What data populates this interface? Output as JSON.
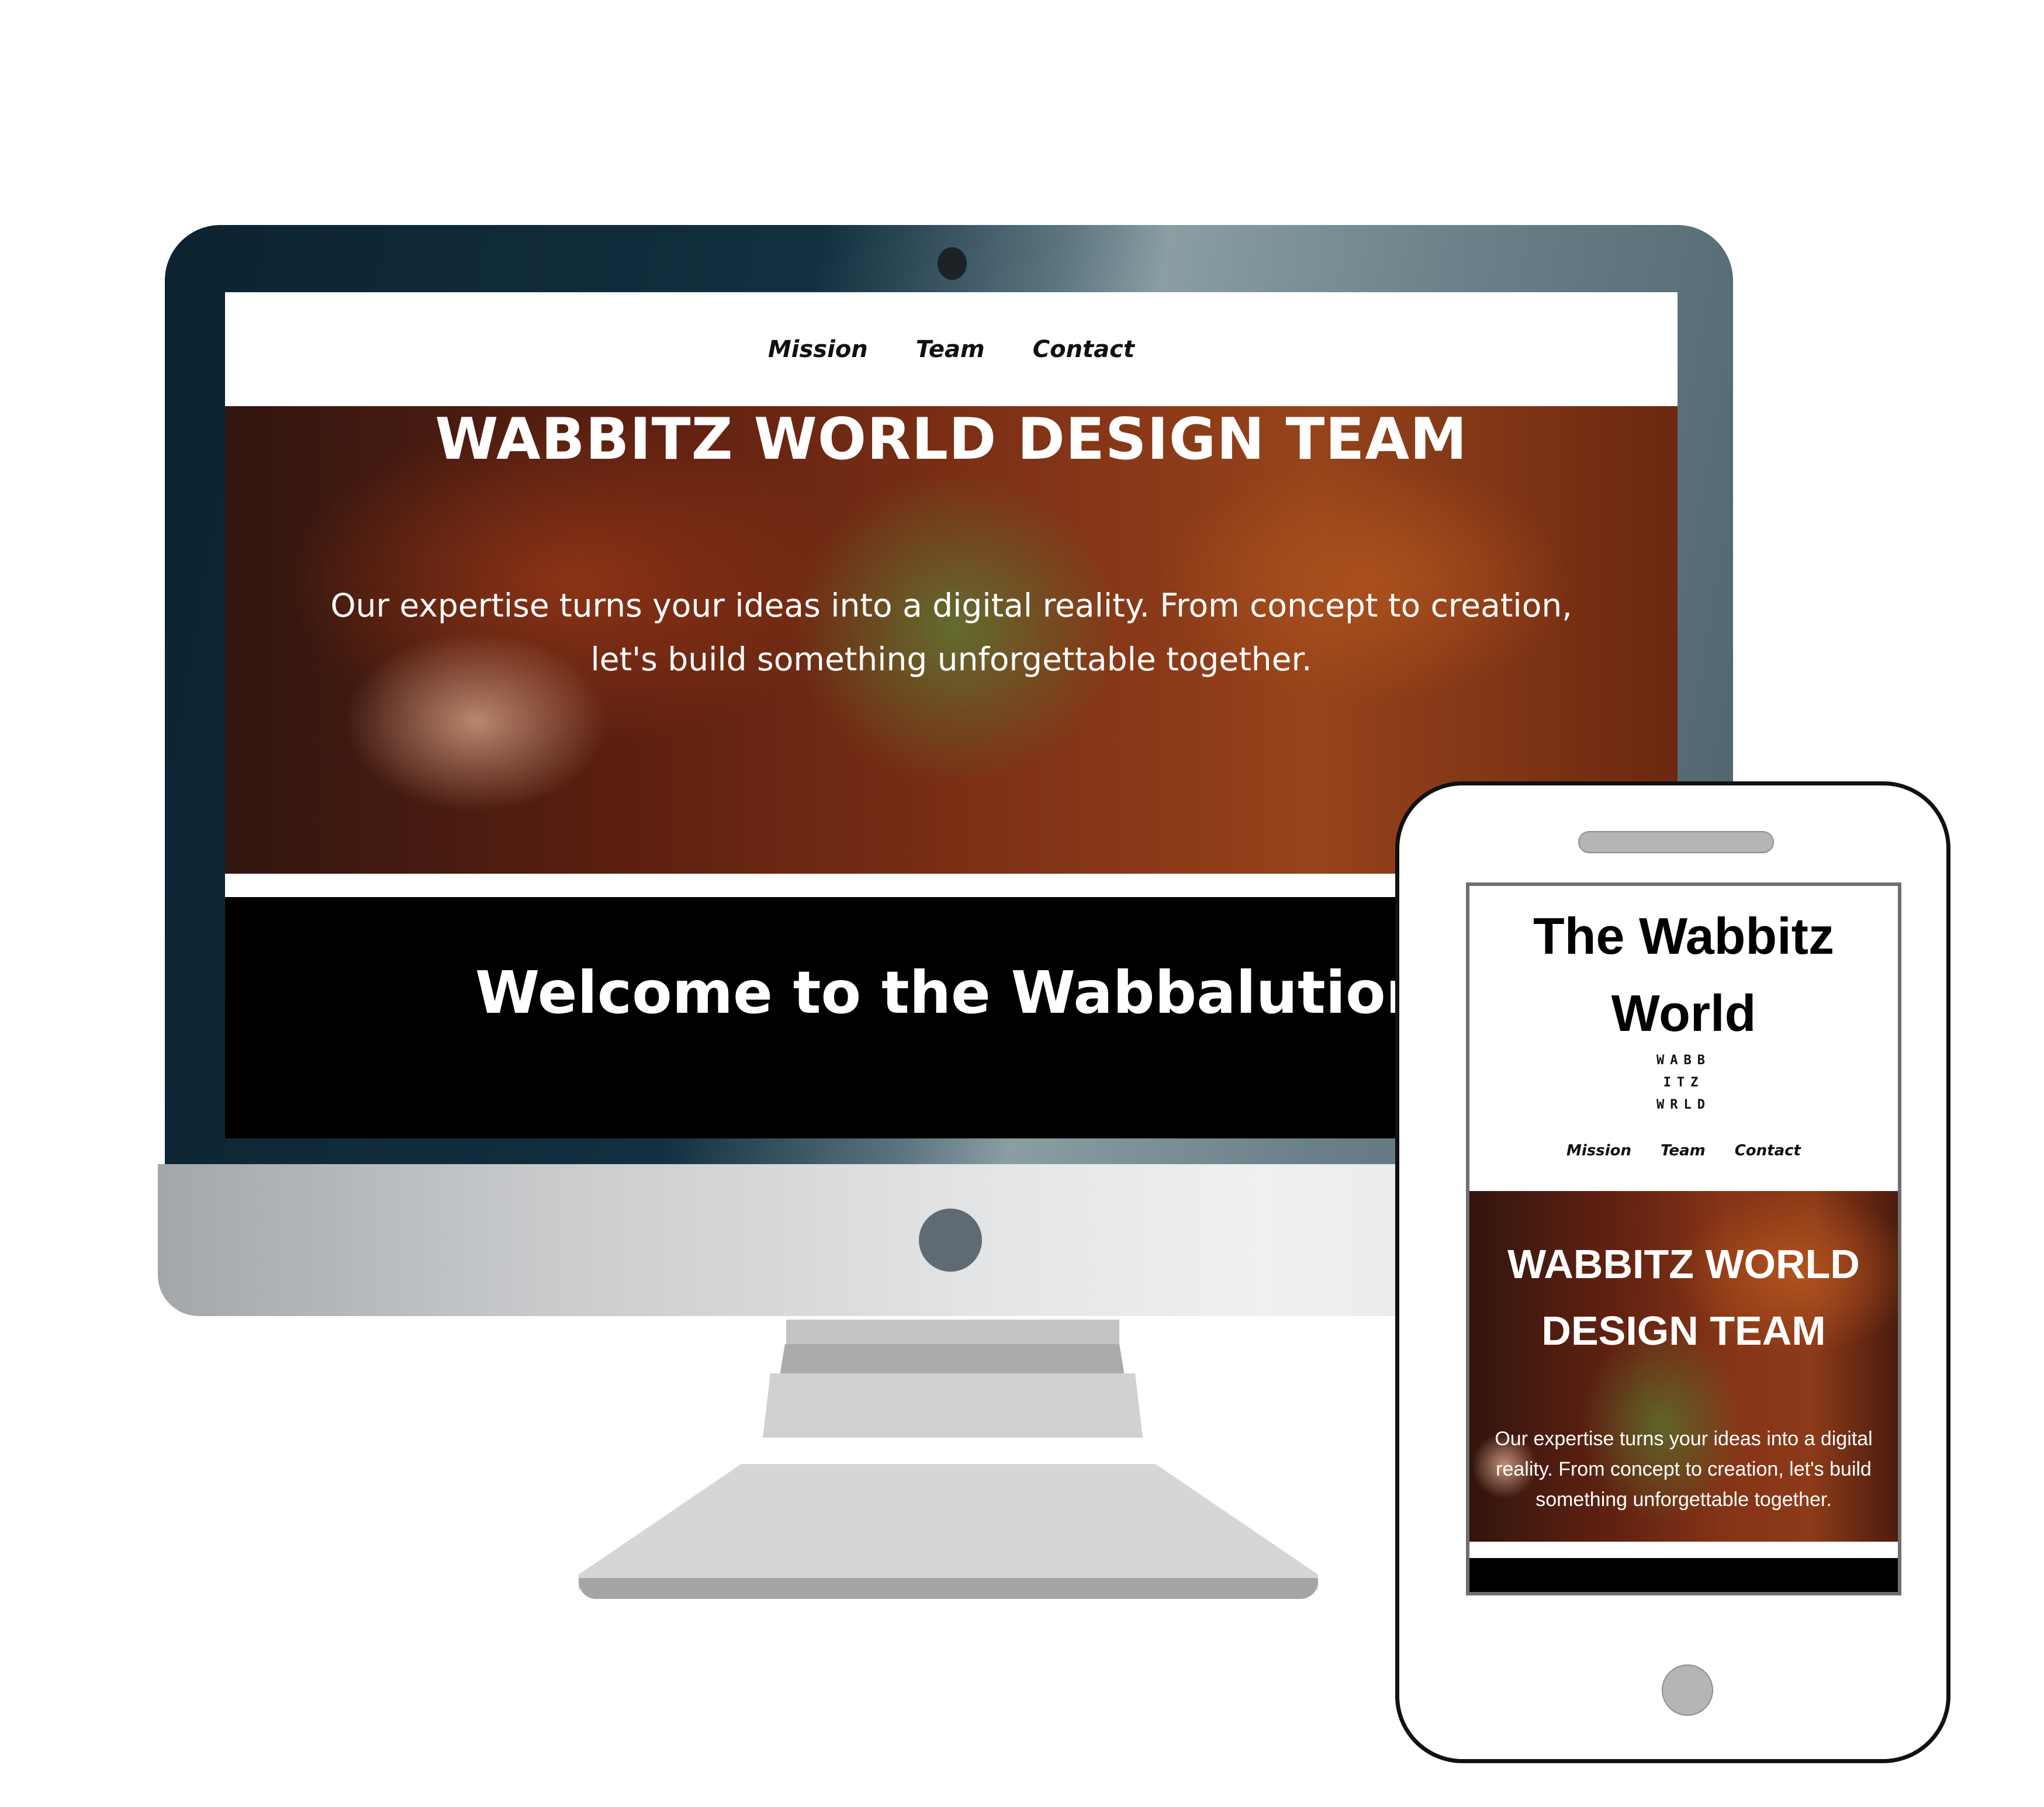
{
  "desktop": {
    "nav": {
      "items": [
        "Mission",
        "Team",
        "Contact"
      ]
    },
    "hero": {
      "title": "WABBITZ WORLD DESIGN TEAM",
      "text_line1": "Our expertise turns your ideas into a digital reality. From concept to creation,",
      "text_line2": "let's build something unforgettable together."
    },
    "welcome": "Welcome to the Wabbalution"
  },
  "mobile": {
    "title_line1": "The Wabbitz",
    "title_line2": "World",
    "logo_lines": [
      "WABB",
      "ITZ",
      "WRLD"
    ],
    "nav": {
      "items": [
        "Mission",
        "Team",
        "Contact"
      ]
    },
    "hero": {
      "title_line1": "WABBITZ WORLD",
      "title_line2": "DESIGN TEAM",
      "text_line1": "Our expertise turns your ideas into a digital",
      "text_line2": "reality. From concept to creation, let's build",
      "text_line3": "something unforgettable together."
    }
  },
  "colors": {
    "hero_accent": "#c55a24",
    "background": "#ffffff",
    "footer_band": "#000000"
  }
}
